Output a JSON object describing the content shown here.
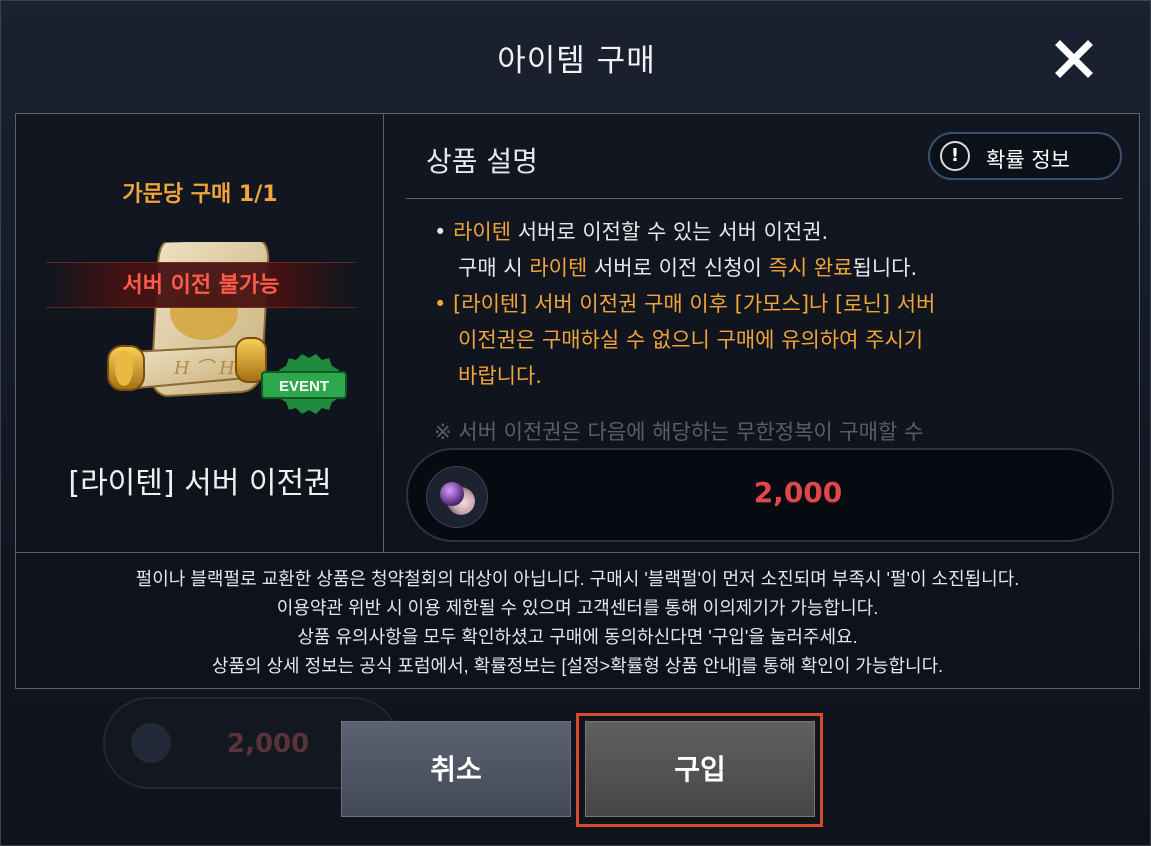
{
  "dialog": {
    "title": "아이템 구매",
    "close_icon": "close-icon"
  },
  "item": {
    "purchase_limit": "가문당 구매 1/1",
    "ribbon": "서버 이전 불가능",
    "badge": "EVENT",
    "name": "[라이텐] 서버 이전권"
  },
  "description": {
    "title": "상품 설명",
    "probability_button": "확률 정보",
    "line1_bullet": "• ",
    "line1_hl": "라이텐",
    "line1_rest": " 서버로 이전할 수 있는 서버 이전권.",
    "line2_a": "구매 시 ",
    "line2_hl": "라이텐",
    "line2_b": " 서버로 이전 신청이 ",
    "line2_hl2": "즉시 완료",
    "line2_c": "됩니다.",
    "line3": "• [라이텐] 서버 이전권 구매 이후 [가모스]나 [로닌] 서버",
    "line4": "이전권은 구매하실 수 없으니 구매에 유의하여 주시기",
    "line5": "바랍니다.",
    "line6_faded": "※ 서버 이전권은 다음에 해당하는 무한정복이 구매할 수"
  },
  "price": {
    "currency_icon": "pearl-icon",
    "value": "2,000"
  },
  "notice": {
    "line1": "펄이나 블랙펄로 교환한 상품은 청약철회의 대상이 아닙니다. 구매시 '블랙펄'이 먼저 소진되며 부족시 '펄'이 소진됩니다.",
    "line2": "이용약관 위반 시 이용 제한될 수 있으며 고객센터를 통해 이의제기가 가능합니다.",
    "line3": "상품 유의사항을 모두 확인하셨고 구매에 동의하신다면 '구입'을 눌러주세요.",
    "line4": "상품의 상세 정보는 공식 포럼에서, 확률정보는 [설정>확률형 상품 안내]를 통해 확인이 가능합니다."
  },
  "background": {
    "ghost_price": "2,000"
  },
  "buttons": {
    "cancel": "취소",
    "buy": "구입"
  },
  "colors": {
    "accent_orange": "#f0a43a",
    "price_red": "#e0474b",
    "ribbon_red": "#ff5a4a",
    "highlight_border": "#d94a2c"
  }
}
